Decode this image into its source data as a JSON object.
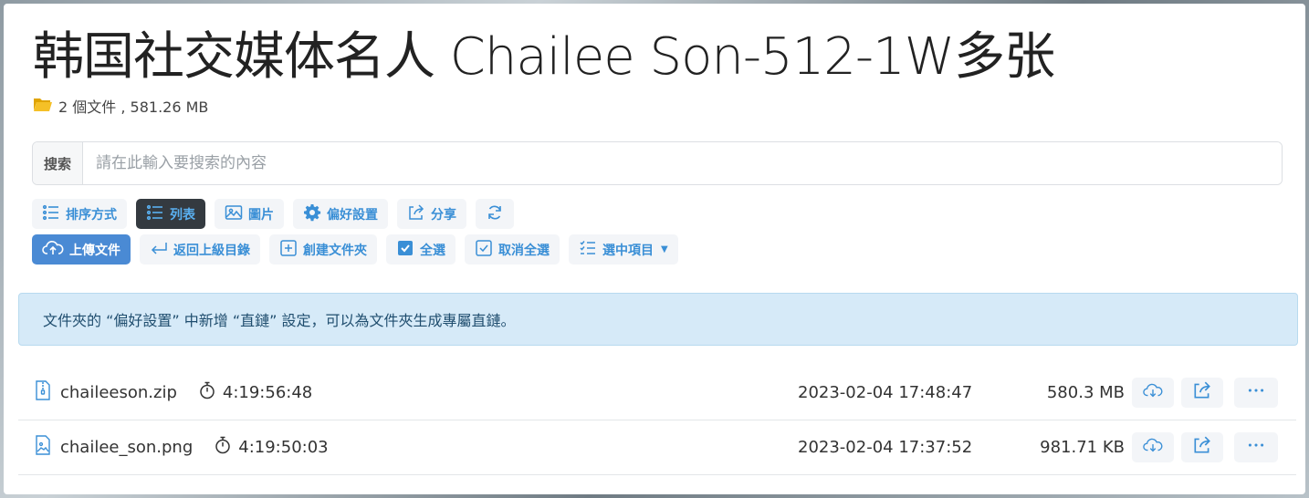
{
  "header": {
    "title": "韩国社交媒体名人 Chailee Son-512-1W多张",
    "meta": "2 個文件 , 581.26 MB"
  },
  "search": {
    "label": "搜索",
    "placeholder": "請在此輸入要搜索的內容"
  },
  "toolbar": {
    "sort": "排序方式",
    "list": "列表",
    "images": "圖片",
    "prefs": "偏好設置",
    "share": "分享",
    "upload": "上傳文件",
    "up_dir": "返回上級目錄",
    "new_folder": "創建文件夾",
    "select_all": "全選",
    "deselect_all": "取消全選",
    "selected_items": "選中項目"
  },
  "notice": "文件夾的 “偏好設置” 中新增 “直鏈” 設定，可以為文件夾生成專屬直鏈。",
  "files": [
    {
      "name": "chaileeson.zip",
      "duration": "4:19:56:48",
      "date": "2023-02-04 17:48:47",
      "size": "580.3 MB"
    },
    {
      "name": "chailee_son.png",
      "duration": "4:19:50:03",
      "date": "2023-02-04 17:37:52",
      "size": "981.71 KB"
    }
  ],
  "colors": {
    "accent": "#3a8fd6",
    "primary": "#4a8ad4",
    "dark": "#343a40",
    "alert_bg": "#d6eaf8",
    "folder": "#f0b400"
  }
}
